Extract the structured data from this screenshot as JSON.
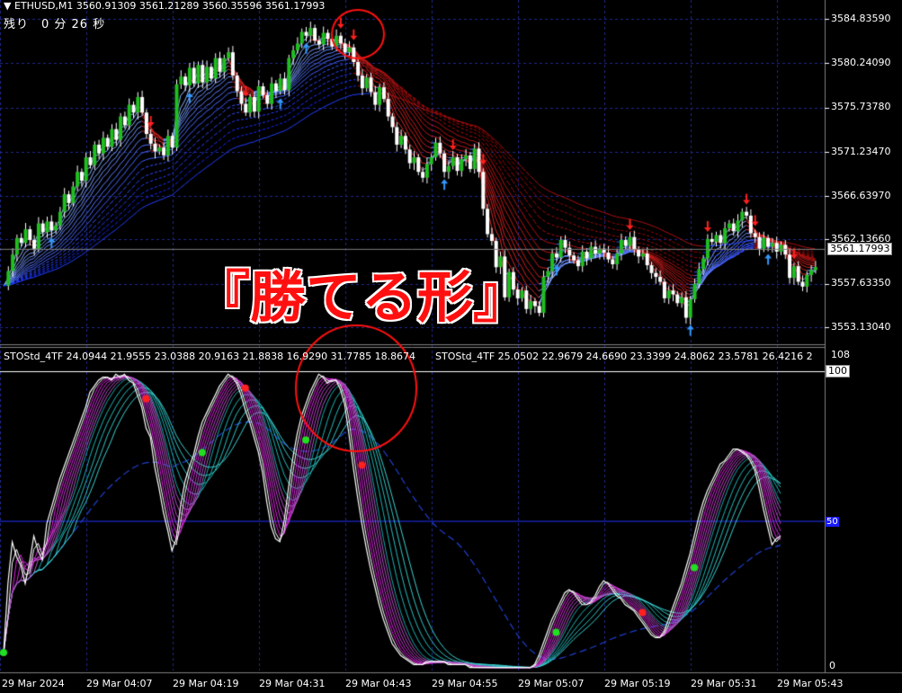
{
  "header": {
    "symbol": "ETHUSD,M1",
    "ohlc": "3560.91309 3561.21289 3560.35596 3561.17993",
    "countdown": "残り　0 分 26 秒"
  },
  "price_axis": {
    "labels": [
      "3584.83590",
      "3580.24090",
      "3575.73780",
      "3571.23470",
      "3566.63970",
      "3562.13660",
      "3557.63350",
      "3553.13040"
    ],
    "current_price": "3561.17993"
  },
  "indicator": {
    "header_1": "STOStd_4TF 24.0944 21.9555 23.0388 20.9163 21.8838 16.9290 31.7785 18.8674",
    "header_2": "STOStd_4TF 25.0502 22.9679 24.6690 23.3399 24.8062 23.5781 26.4216 2",
    "axis_top": "108",
    "level_100": "100",
    "level_50": "50",
    "axis_bottom": "0"
  },
  "time_axis": [
    "29 Mar 2024",
    "29 Mar 04:07",
    "29 Mar 04:19",
    "29 Mar 04:31",
    "29 Mar 04:43",
    "29 Mar 04:55",
    "29 Mar 05:07",
    "29 Mar 05:19",
    "29 Mar 05:31",
    "29 Mar 05:43"
  ],
  "annotation": {
    "text": "『勝てる形』",
    "color": "#ff1010"
  },
  "colors": {
    "background": "#000000",
    "grid": "#1e2a8c",
    "bull_candle": "#1fbf1f",
    "bear_candle": "#ffffff",
    "up_arrow": "#3399ff",
    "down_arrow": "#ff2020",
    "circle": "#ff1010",
    "stoch_main": "#ffffff",
    "stoch_magenta": "#e020e0",
    "stoch_cyan": "#20c0c0"
  },
  "series": {
    "close": [
      3557.4,
      3558.9,
      3560.6,
      3562.3,
      3561.8,
      3563.2,
      3562.1,
      3561.2,
      3563.8,
      3562.9,
      3564.0,
      3563.1,
      3563.6,
      3565.0,
      3566.8,
      3565.9,
      3567.6,
      3569.1,
      3568.2,
      3570.6,
      3569.8,
      3571.9,
      3571.0,
      3572.6,
      3571.7,
      3573.5,
      3572.4,
      3574.8,
      3573.9,
      3576.0,
      3575.2,
      3576.8,
      3575.2,
      3573.0,
      3572.0,
      3571.2,
      3571.6,
      3570.8,
      3572.8,
      3571.6,
      3578.1,
      3578.9,
      3578.0,
      3579.8,
      3578.2,
      3580.1,
      3578.3,
      3579.9,
      3578.7,
      3580.8,
      3579.4,
      3580.8,
      3581.4,
      3579.0,
      3577.4,
      3576.1,
      3575.2,
      3576.8,
      3575.3,
      3577.9,
      3577.0,
      3576.1,
      3578.2,
      3577.4,
      3578.7,
      3577.5,
      3580.8,
      3581.6,
      3582.3,
      3583.5,
      3583.1,
      3583.9,
      3582.6,
      3582.2,
      3583.4,
      3582.8,
      3582.0,
      3583.1,
      3582.3,
      3581.4,
      3581.9,
      3580.4,
      3579.0,
      3577.7,
      3578.8,
      3577.3,
      3576.0,
      3577.8,
      3576.6,
      3574.8,
      3573.7,
      3571.9,
      3572.8,
      3571.4,
      3570.0,
      3570.6,
      3569.1,
      3568.5,
      3569.9,
      3570.6,
      3572.1,
      3571.0,
      3569.1,
      3569.7,
      3570.6,
      3569.2,
      3570.4,
      3570.8,
      3569.4,
      3571.5,
      3569.1,
      3565.3,
      3562.7,
      3562.0,
      3559.3,
      3560.4,
      3556.2,
      3558.8,
      3557.0,
      3556.1,
      3556.9,
      3555.0,
      3555.8,
      3555.3,
      3554.6,
      3558.3,
      3558.9,
      3560.7,
      3560.3,
      3562.1,
      3561.3,
      3560.5,
      3560.0,
      3559.4,
      3560.9,
      3560.2,
      3561.4,
      3560.7,
      3561.2,
      3560.8,
      3560.1,
      3559.6,
      3560.7,
      3562.1,
      3561.5,
      3562.4,
      3561.1,
      3560.4,
      3560.7,
      3559.5,
      3558.7,
      3558.3,
      3557.8,
      3556.1,
      3556.9,
      3556.5,
      3555.6,
      3556.2,
      3554.1,
      3556.0,
      3557.6,
      3559.1,
      3560.2,
      3562.2,
      3561.9,
      3562.6,
      3561.8,
      3563.3,
      3563.8,
      3563.0,
      3564.1,
      3565.0,
      3564.6,
      3562.8,
      3562.4,
      3561.2,
      3562.3,
      3561.4,
      3561.8,
      3560.9,
      3561.6,
      3560.6,
      3558.2,
      3559.4,
      3557.8,
      3557.3,
      3558.5,
      3559.0,
      3559.3
    ],
    "stoch": [
      6,
      29,
      43,
      38,
      35,
      29,
      36,
      45,
      40,
      37,
      49,
      54,
      59,
      64,
      68,
      72,
      76,
      80,
      84,
      88,
      93,
      95,
      97,
      98,
      98,
      97,
      99,
      98,
      99,
      97,
      96,
      92,
      88,
      81,
      78,
      68,
      61,
      53,
      47,
      40,
      44,
      55,
      63,
      68,
      72,
      78,
      83,
      86,
      89,
      92,
      95,
      97,
      99,
      98,
      96,
      92,
      87,
      83,
      78,
      73,
      66,
      56,
      48,
      44,
      43,
      50,
      61,
      71,
      79,
      85,
      89,
      93,
      96,
      99,
      98,
      96,
      97,
      97,
      94,
      89,
      79,
      68,
      58,
      49,
      41,
      34,
      28,
      22,
      17,
      13,
      9,
      7,
      5,
      4,
      3,
      2,
      2,
      2,
      3,
      3,
      3,
      3,
      3,
      2,
      2,
      2,
      2,
      2,
      1,
      1,
      1,
      1,
      1,
      1,
      1,
      1,
      1,
      1,
      1,
      1,
      1,
      1,
      1,
      2,
      5,
      9,
      13,
      17,
      20,
      23,
      26,
      27,
      26,
      24,
      22,
      22,
      23,
      25,
      28,
      30,
      29,
      27,
      25,
      24,
      22,
      21,
      20,
      18,
      16,
      14,
      12,
      11,
      11,
      13,
      17,
      21,
      25,
      29,
      34,
      39,
      45,
      51,
      56,
      60,
      63,
      66,
      69,
      70,
      72,
      74,
      74,
      73,
      72,
      70,
      67,
      61,
      54,
      48,
      42,
      44,
      45
    ]
  }
}
